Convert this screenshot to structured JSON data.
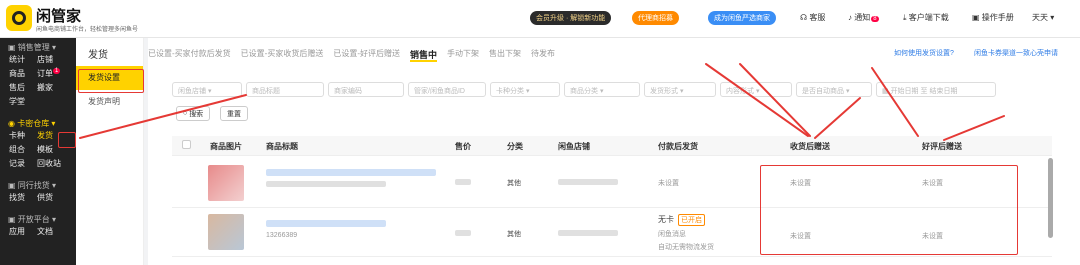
{
  "header": {
    "app_name": "闲管家",
    "app_sub": "闲鱼电商铺工作台，轻松管理多闲鱼号",
    "vip": "会员升级 · 解锁新功能",
    "agent": "代理商招募",
    "apply": "成为闲鱼严选商家",
    "service": "客服",
    "notice": "通知",
    "notice_count": "8",
    "download": "客户端下载",
    "manual": "操作手册",
    "user": "天天"
  },
  "sidebar": {
    "sales_mgmt": "销售管理",
    "row1": [
      "统计",
      "店铺"
    ],
    "row2": [
      "商品",
      "订单"
    ],
    "order_badge": "1",
    "row3": [
      "售后",
      "搬家"
    ],
    "row4": [
      "学堂"
    ],
    "card_repo": "卡密仓库",
    "row5": [
      "卡种",
      "发货"
    ],
    "row6": [
      "组合",
      "模板"
    ],
    "row7": [
      "记录",
      "回收站"
    ],
    "peer": "同行找货",
    "row8": [
      "找货",
      "供货"
    ],
    "open": "开放平台",
    "row9": [
      "应用",
      "文档"
    ]
  },
  "subnav": {
    "title": "发货",
    "items": [
      "发货设置",
      "发货声明"
    ]
  },
  "tabs": [
    "已设置-买家付款后发货",
    "已设置-买家收货后赠送",
    "已设置-好评后赠送",
    "销售中",
    "手动下架",
    "售出下架",
    "待发布"
  ],
  "help": [
    "如何使用发货设置?",
    "闲鱼卡券渠道一致心壳申请"
  ],
  "filters": [
    "闲鱼店铺",
    "商品标题",
    "商家编码",
    "管家/闲鱼商品ID",
    "卡种分类",
    "商品分类",
    "发货形式",
    "内容形式",
    "是否自动商品",
    "开始日期",
    "至",
    "结束日期"
  ],
  "buttons": {
    "search": "搜索",
    "reset": "重置"
  },
  "table": {
    "headers": [
      "商品图片",
      "商品标题",
      "售价",
      "分类",
      "闲鱼店铺",
      "付款后发货",
      "收货后赠送",
      "好评后赠送"
    ],
    "rows": [
      {
        "title_suffix": "",
        "category": "其他",
        "pay": "未设置",
        "receive": "未设置",
        "review": "未设置"
      },
      {
        "title_suffix": "13266389",
        "category": "其他",
        "pay_card": "无卡",
        "pay_status": "已开启",
        "pay_msg": "闲鱼消息",
        "pay_auto": "自动无需物流发货",
        "receive": "未设置",
        "review": "未设置"
      }
    ]
  },
  "colors": {
    "accent": "#ffd200",
    "annotation": "#e53935",
    "link": "#2d7be5"
  }
}
